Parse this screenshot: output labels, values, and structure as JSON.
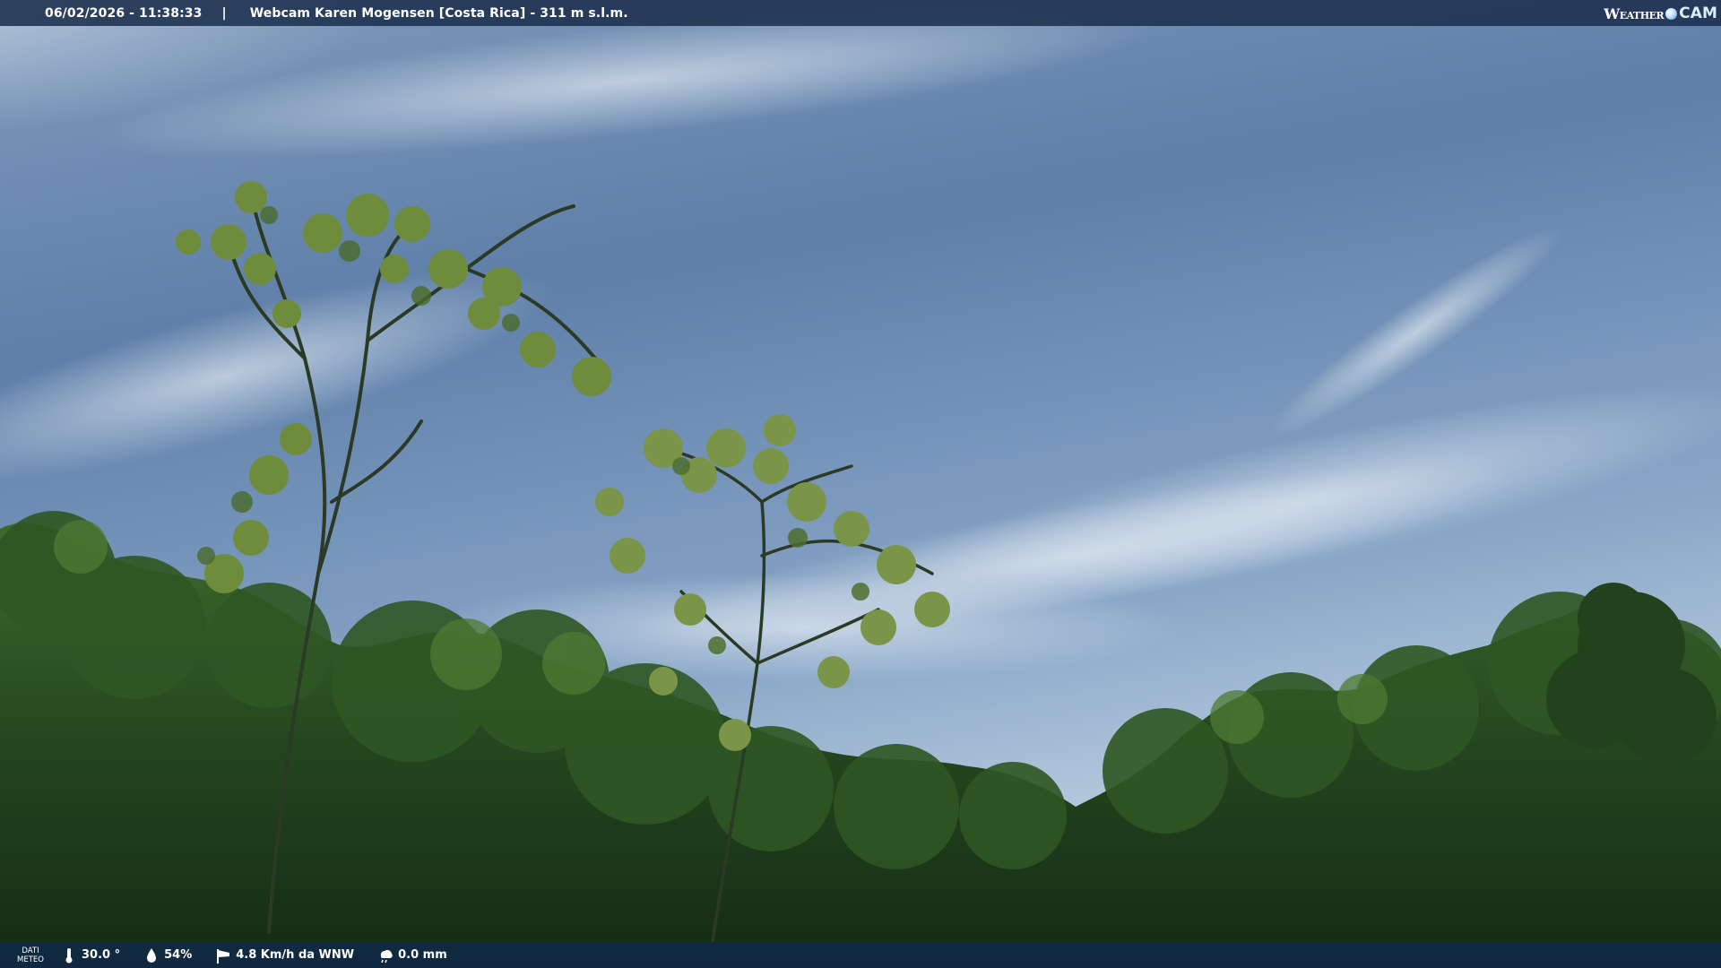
{
  "header": {
    "datetime": "06/02/2026 - 11:38:33",
    "separator": "|",
    "title": "Webcam Karen Mogensen [Costa Rica] - 311 m s.l.m."
  },
  "logo": {
    "text_weather": "Weather",
    "text_cam": "CAM"
  },
  "weather": {
    "label_line1": "DATI",
    "label_line2": "METEO",
    "temperature": "30.0 °",
    "humidity": "54%",
    "wind": "4.8 Km/h da WNW",
    "rain": "0.0 mm"
  },
  "icons": {
    "temperature": "thermometer-icon",
    "humidity": "droplet-icon",
    "wind": "windsock-icon",
    "rain": "rain-cloud-icon"
  },
  "colors": {
    "sky_top": "#5f7fa8",
    "sky_haze": "#b9cde0",
    "foliage_dark": "#1c3a1a",
    "foliage_light": "#6e8f3a",
    "bar": "#1c304e"
  }
}
